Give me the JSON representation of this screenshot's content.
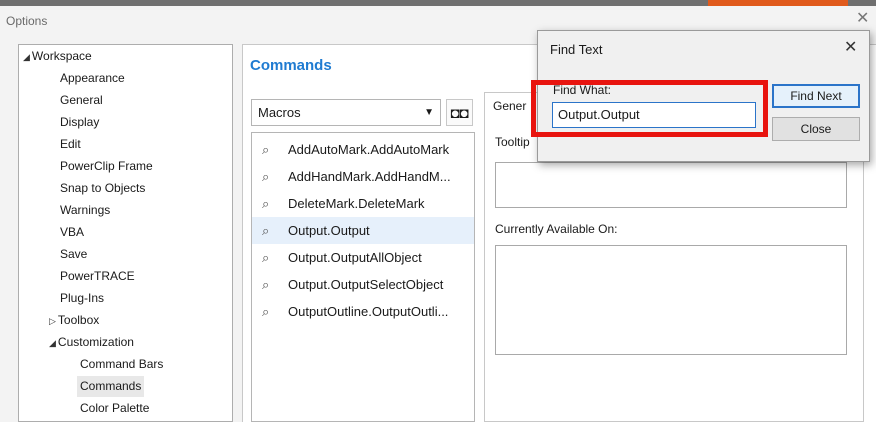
{
  "window": {
    "title": "Options",
    "close_icon": "close-icon"
  },
  "tree": [
    {
      "label": "Workspace",
      "expander": "◢",
      "level": 0
    },
    {
      "label": "Appearance",
      "level": 1
    },
    {
      "label": "General",
      "level": 1
    },
    {
      "label": "Display",
      "level": 1
    },
    {
      "label": "Edit",
      "level": 1
    },
    {
      "label": "PowerClip Frame",
      "level": 1
    },
    {
      "label": "Snap to Objects",
      "level": 1
    },
    {
      "label": "Warnings",
      "level": 1
    },
    {
      "label": "VBA",
      "level": 1
    },
    {
      "label": "Save",
      "level": 1
    },
    {
      "label": "PowerTRACE",
      "level": 1
    },
    {
      "label": "Plug-Ins",
      "level": 1
    },
    {
      "label": "Toolbox",
      "expander": "▷",
      "level": 1
    },
    {
      "label": "Customization",
      "expander": "◢",
      "level": 1
    },
    {
      "label": "Command Bars",
      "level": 2
    },
    {
      "label": "Commands",
      "level": 2,
      "selected": true
    },
    {
      "label": "Color Palette",
      "level": 2
    }
  ],
  "commands": {
    "title": "Commands",
    "category_selected": "Macros",
    "find_icon": "binoculars-icon",
    "items": [
      "AddAutoMark.AddAutoMark",
      "AddHandMark.AddHandM...",
      "DeleteMark.DeleteMark",
      "Output.Output",
      "Output.OutputAllObject",
      "Output.OutputSelectObject",
      "OutputOutline.OutputOutli..."
    ],
    "selected_index": 3
  },
  "details": {
    "tab_general": "Gener",
    "tooltip_label": "Tooltip",
    "available_label": "Currently Available On:"
  },
  "find_dialog": {
    "title": "Find Text",
    "label": "Find What:",
    "value": "Output.Output",
    "find_next": "Find Next",
    "close": "Close",
    "highlight_color": "#e8140f"
  }
}
